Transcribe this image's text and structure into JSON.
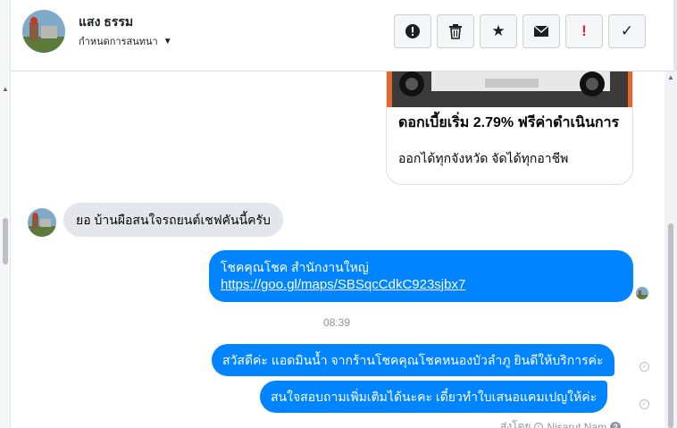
{
  "header": {
    "name": "แสง ธรรม",
    "subtitle": "กำหนดการสนทนา",
    "actions": [
      {
        "name": "report-icon",
        "glyph": "!"
      },
      {
        "name": "trash-icon",
        "glyph": "🗑"
      },
      {
        "name": "star-icon",
        "glyph": "★"
      },
      {
        "name": "envelope-icon",
        "glyph": "✉"
      },
      {
        "name": "flag-icon",
        "glyph": "!"
      },
      {
        "name": "checkmark-icon",
        "glyph": "✓"
      }
    ]
  },
  "card": {
    "title": "ดอกเบี้ยเริ่ม 2.79% ฟรีค่าดำเนินการ",
    "description": "ออกได้ทุกจังหวัด จัดได้ทุกอาชีพ"
  },
  "messages": {
    "incoming": "ยอ  บ้านผือสนใจรถยนต์เชฟคันนี้ครับ",
    "outgoing_1_line1": "โชคคุณโชค สำนักงานใหญ่",
    "outgoing_1_link": "https://goo.gl/maps/SBSqcCdkC923sjbx7",
    "timestamp": "08:39",
    "outgoing_2": "สวัสดีค่ะ แอดมินน้ำ จากร้านโชคคุณโชคหนองบัวลำภู ยินดีให้บริการค่ะ",
    "outgoing_3": "สนใจสอบถามเพิ่มเติมได้นะคะ เดี๋ยวทำใบเสนอแคมเปญให้ค่ะ",
    "sent_by": "ส่งโดย",
    "sender_name": "Nisarut Nam"
  },
  "colors": {
    "accent": "#0084ff",
    "incoming_bubble": "#e4e6eb",
    "alert_red": "#e41e3f"
  }
}
